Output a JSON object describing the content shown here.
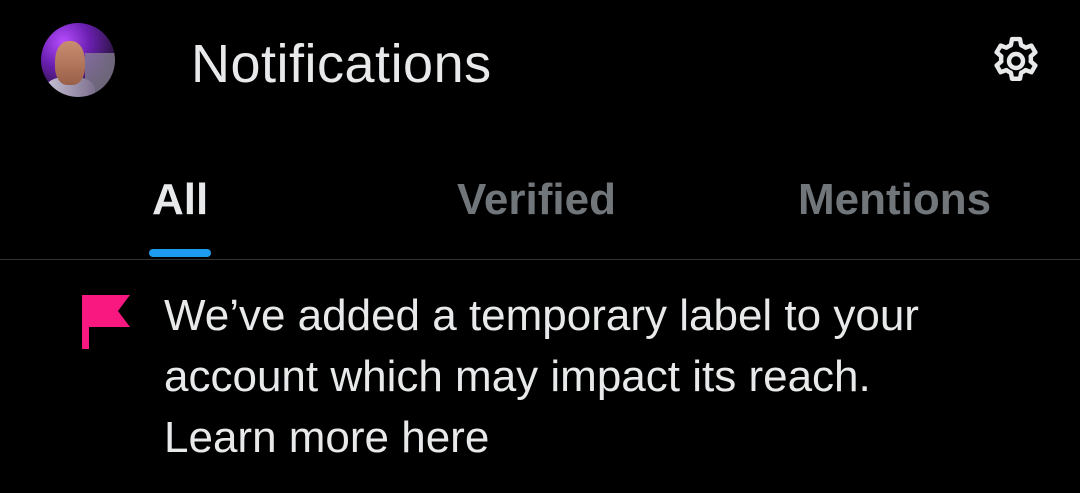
{
  "header": {
    "title": "Notifications",
    "avatar_icon": "profile-avatar",
    "settings_icon": "gear-icon"
  },
  "tabs": [
    {
      "label": "All",
      "active": true
    },
    {
      "label": "Verified",
      "active": false
    },
    {
      "label": "Mentions",
      "active": false
    }
  ],
  "notice": {
    "icon": "flag-icon",
    "message": "We’ve added a temporary label to your account which may impact its reach.",
    "link_text": "Learn more here"
  },
  "colors": {
    "background": "#000000",
    "text_primary": "#e7e9ea",
    "text_secondary": "#71767b",
    "accent": "#1d9bf0",
    "flag": "#f91880",
    "divider": "#2f3336"
  }
}
